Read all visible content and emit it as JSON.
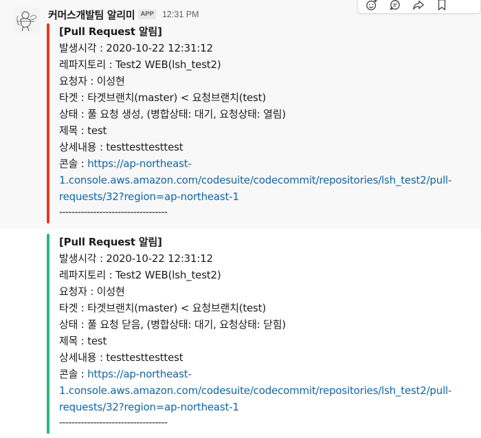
{
  "sender": {
    "name": "커머스개발팀 알리미",
    "badge": "APP",
    "time": "12:31 PM"
  },
  "toolbar": {
    "icons": [
      "emoji-reaction-icon",
      "reply-thread-icon",
      "share-icon",
      "bookmark-icon"
    ]
  },
  "colors": {
    "attachment_open": "#e8381c",
    "attachment_closed": "#2eb67d",
    "link": "#1264a3"
  },
  "messages": [
    {
      "title": "[Pull Request 알림]",
      "time_line": "발생시각 : 2020-10-22 12:31:12",
      "repo_line": "레파지토리 : Test2 WEB(lsh_test2)",
      "requester_line": "요청자 : 이성현",
      "target_line": "타겟 : 타겟브랜치(master) < 요청브랜치(test)",
      "status_line": "상태 : 풀 요청 생성, (병합상태: 대기, 요청상태: 열림)",
      "subject_line": "제목 : test",
      "detail_line": "상세내용 : testtesttesttest",
      "console_label": "콘솔 : ",
      "console_link": "https://ap-northeast-1.console.aws.amazon.com/codesuite/codecommit/repositories/lsh_test2/pull-requests/32?region=ap-northeast-1",
      "console_link_l1": "https://ap-northeast-",
      "console_link_l2": "1.console.aws.amazon.com/codesuite/codecommit/repositories/lsh_test2/pull-",
      "console_link_l3": "requests/32?region=ap-northeast-1",
      "divider": "-----------------------------------"
    },
    {
      "title": "[Pull Request 알림]",
      "time_line": "발생시각 : 2020-10-22 12:31:12",
      "repo_line": "레파지토리 : Test2 WEB(lsh_test2)",
      "requester_line": "요청자 : 이성현",
      "target_line": "타겟 : 타겟브랜치(master) < 요청브랜치(test)",
      "status_line": "상태 : 풀 요청 닫음, (병합상태: 대기, 요청상태: 닫힘)",
      "subject_line": "제목 : test",
      "detail_line": "상세내용 : testtesttesttest",
      "console_label": "콘솔 : ",
      "console_link": "https://ap-northeast-1.console.aws.amazon.com/codesuite/codecommit/repositories/lsh_test2/pull-requests/32?region=ap-northeast-1",
      "console_link_l1": "https://ap-northeast-",
      "console_link_l2": "1.console.aws.amazon.com/codesuite/codecommit/repositories/lsh_test2/pull-",
      "console_link_l3": "requests/32?region=ap-northeast-1",
      "divider": "-----------------------------------"
    }
  ]
}
